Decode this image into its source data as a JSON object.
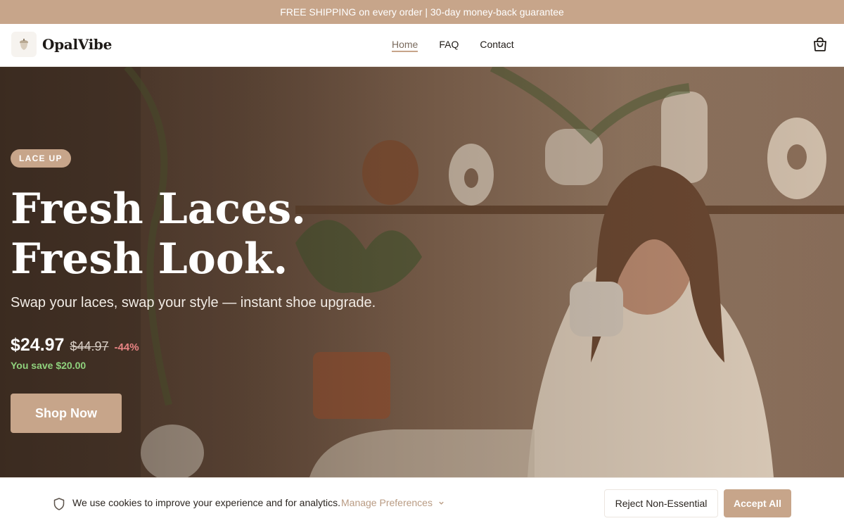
{
  "announcement": {
    "text": "FREE SHIPPING on every order | 30-day money-back guarantee"
  },
  "brand": {
    "name": "OpalVibe",
    "logo_icon": "acorn-icon",
    "accent": "#c7a58a"
  },
  "nav": {
    "links": [
      {
        "label": "Home",
        "active": true
      },
      {
        "label": "FAQ",
        "active": false
      },
      {
        "label": "Contact",
        "active": false
      }
    ],
    "cart_icon": "shopping-bag-icon"
  },
  "hero": {
    "badge": "LACE UP",
    "headline_line1": "Fresh Laces.",
    "headline_line2": "Fresh Look.",
    "subheadline": "Swap your laces, swap your style — instant shoe upgrade.",
    "price": "$24.97",
    "compare_price": "$44.97",
    "discount": "-44%",
    "savings": "You save $20.00",
    "cta": "Shop Now"
  },
  "cookie_banner": {
    "icon": "shield-icon",
    "message": "We use cookies to improve your experience and for analytics.",
    "manage_label": "Manage Preferences",
    "reject_label": "Reject Non-Essential",
    "accept_label": "Accept All"
  }
}
